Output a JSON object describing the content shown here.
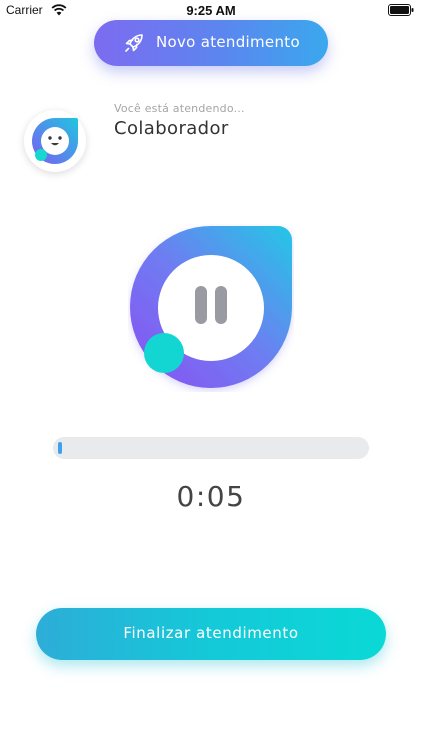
{
  "status_bar": {
    "carrier": "Carrier",
    "time": "9:25 AM"
  },
  "header": {
    "new_call_label": "Novo atendimento"
  },
  "attendant": {
    "label": "Você está atendendo...",
    "name": "Colaborador"
  },
  "player": {
    "progress": 0.01,
    "timer": "0:05"
  },
  "footer": {
    "finish_label": "Finalizar atendimento"
  },
  "colors": {
    "primary_purple": "#7d6bf0",
    "primary_blue": "#3aa8ee",
    "accent_teal": "#0ad9d6",
    "progress_fill": "#3ea1ee"
  },
  "icons": {
    "status": [
      "wifi-icon",
      "battery-icon"
    ],
    "header": "rocket-icon",
    "avatar": "face-icon",
    "player": "pause-icon"
  }
}
